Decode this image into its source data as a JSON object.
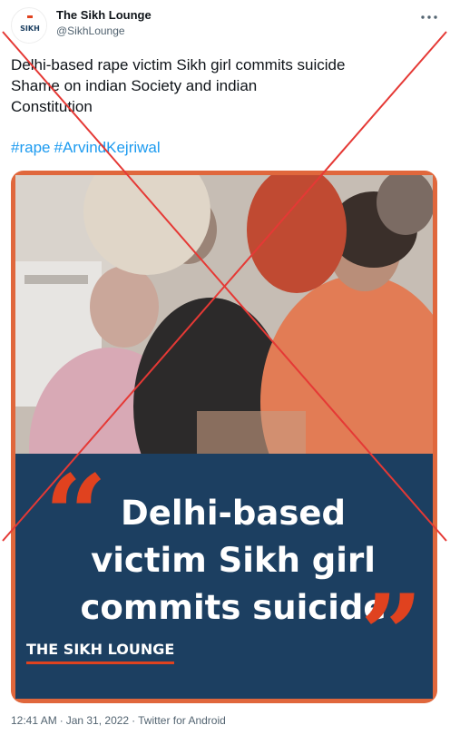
{
  "author": {
    "name": "The Sikh Lounge",
    "handle": "@SikhLounge",
    "avatar_text": "SIKH",
    "avatar_icon": "sikh-lounge-logo"
  },
  "more_icon": "more-dots-icon",
  "tweet": {
    "lines": [
      "Delhi-based rape victim Sikh girl commits suicide",
      "Shame on indian Society and indian",
      "Constitution"
    ],
    "hashtags": [
      "#rape",
      "#ArvindKejriwal"
    ]
  },
  "media": {
    "headline_lines": [
      "Delhi-based",
      "victim Sikh girl",
      "commits suicide"
    ],
    "quote_open": "“",
    "quote_close": "”",
    "brand_tag": "THE SIKH LOUNGE"
  },
  "footer": {
    "time": "12:41 AM",
    "date": "Jan 31, 2022",
    "source": "Twitter for Android",
    "separator": "·"
  },
  "colors": {
    "overlay_x": "#e53935",
    "banner_bg": "#1c3f61",
    "quote_color": "#e0421f",
    "hashtag": "#1d9bf0"
  }
}
